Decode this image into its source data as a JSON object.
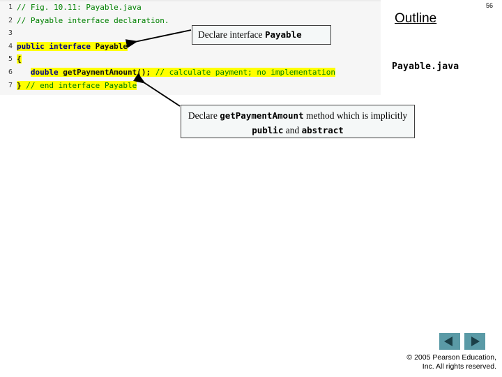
{
  "outline": {
    "title": "Outline",
    "page_number": "56",
    "filename": "Payable.java"
  },
  "code": {
    "lines": [
      {
        "no": "1",
        "indent": 0,
        "tokens": [
          {
            "text": "// Fig. 10.11: Payable.java",
            "cls": "cmt",
            "hl": false
          }
        ]
      },
      {
        "no": "2",
        "indent": 0,
        "tokens": [
          {
            "text": "// Payable interface declaration.",
            "cls": "cmt",
            "hl": false
          }
        ]
      },
      {
        "no": "3",
        "indent": 0,
        "tokens": []
      },
      {
        "no": "4",
        "indent": 0,
        "tokens": [
          {
            "text": "public",
            "cls": "kw",
            "hl": true
          },
          {
            "text": " ",
            "cls": "plain",
            "hl": true
          },
          {
            "text": "interface",
            "cls": "kw",
            "hl": true
          },
          {
            "text": " ",
            "cls": "plain",
            "hl": true
          },
          {
            "text": "Payable",
            "cls": "idn",
            "hl": true
          }
        ]
      },
      {
        "no": "5",
        "indent": 0,
        "tokens": [
          {
            "text": "{",
            "cls": "pun",
            "hl": true
          }
        ]
      },
      {
        "no": "6",
        "indent": 0,
        "tokens": [
          {
            "text": "   ",
            "cls": "plain",
            "hl": false
          },
          {
            "text": "double",
            "cls": "kw",
            "hl": true
          },
          {
            "text": " ",
            "cls": "plain",
            "hl": true
          },
          {
            "text": "getPaymentAmount();",
            "cls": "idn",
            "hl": true
          },
          {
            "text": " ",
            "cls": "plain",
            "hl": true
          },
          {
            "text": "// calculate payment; no implementation",
            "cls": "cmt",
            "hl": true
          }
        ]
      },
      {
        "no": "7",
        "indent": 0,
        "tokens": [
          {
            "text": "}",
            "cls": "pun",
            "hl": true
          },
          {
            "text": " ",
            "cls": "plain",
            "hl": true
          },
          {
            "text": "// end interface Payable",
            "cls": "cmt",
            "hl": true
          }
        ]
      }
    ]
  },
  "callouts": [
    {
      "id": "callout-1",
      "parts": [
        {
          "text": "Declare interface ",
          "mono": false
        },
        {
          "text": "Payable",
          "mono": true
        }
      ]
    },
    {
      "id": "callout-2",
      "parts": [
        {
          "text": "Declare ",
          "mono": false
        },
        {
          "text": "getPaymentAmount",
          "mono": true
        },
        {
          "text": " method which is implicitly ",
          "mono": false
        },
        {
          "text": "public",
          "mono": true
        },
        {
          "text": " and ",
          "mono": false
        },
        {
          "text": "abstract",
          "mono": true
        }
      ]
    }
  ],
  "footer": {
    "nav_prev_label": "Previous slide",
    "nav_next_label": "Next slide",
    "copyright_line1": "© 2005 Pearson Education,",
    "copyright_line2": "Inc.  All rights reserved."
  },
  "colors": {
    "highlight": "#ffff00",
    "comment": "#008000",
    "keyword": "#00008b",
    "panel_bg": "#f6f6f6",
    "nav_button": "#5a9aa6",
    "nav_arrow": "#1b3f47"
  }
}
